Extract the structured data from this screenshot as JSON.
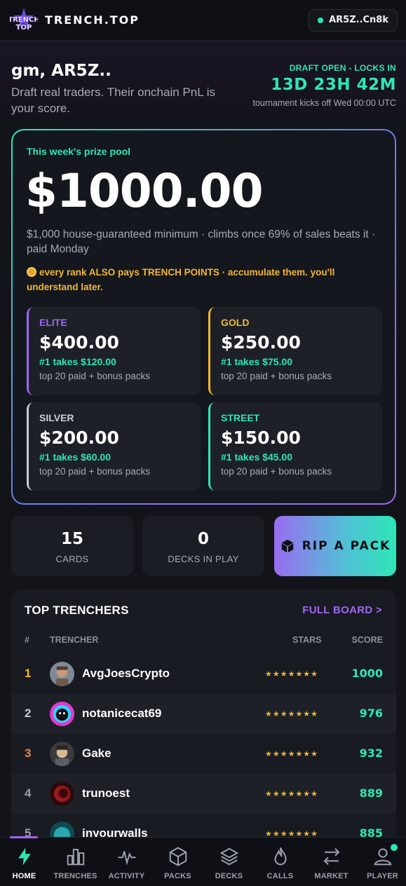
{
  "brand": {
    "logo_text": "TRENCH TOP",
    "name": "TRENCH.TOP",
    "wallet": "AR5Z..Cn8k"
  },
  "hero": {
    "greeting": "gm, AR5Z..",
    "tagline": "Draft real traders. Their onchain PnL is your score.",
    "draft_label": "DRAFT OPEN - LOCKS IN",
    "draft_time": "13D 23H 42M",
    "draft_note": "tournament kicks off Wed 00:00 UTC"
  },
  "prize_pool": {
    "label": "This week's prize pool",
    "amount": "$1000.00",
    "description": "$1,000 house-guaranteed minimum · climbs once 69% of sales beats it · paid Monday",
    "points_note": "every rank ALSO pays TRENCH POINTS · accumulate them. you'll understand later.",
    "tiers": [
      {
        "name": "ELITE",
        "amount": "$400.00",
        "top": "#1 takes $120.00",
        "sub": "top 20 paid + bonus packs",
        "color": "#a266f2"
      },
      {
        "name": "GOLD",
        "amount": "$250.00",
        "top": "#1 takes $75.00",
        "sub": "top 20 paid + bonus packs",
        "color": "#f2b733"
      },
      {
        "name": "SILVER",
        "amount": "$200.00",
        "top": "#1 takes $60.00",
        "sub": "top 20 paid + bonus packs",
        "color": "#c9cdd6"
      },
      {
        "name": "STREET",
        "amount": "$150.00",
        "top": "#1 takes $45.00",
        "sub": "top 20 paid + bonus packs",
        "color": "#2ee6b6"
      }
    ]
  },
  "stats": {
    "cards_value": "15",
    "cards_label": "CARDS",
    "decks_value": "0",
    "decks_label": "DECKS IN PLAY",
    "rip_label": "RIP A PACK"
  },
  "leaderboard": {
    "title": "TOP TRENCHERS",
    "link": "FULL BOARD >",
    "headers": {
      "rank": "#",
      "trencher": "TRENCHER",
      "stars": "STARS",
      "score": "SCORE"
    },
    "rows": [
      {
        "rank": "1",
        "name": "AvgJoesCrypto",
        "stars": "★★★★★★★",
        "score": "1000",
        "rank_color": "#f2b733"
      },
      {
        "rank": "2",
        "name": "notanicecat69",
        "stars": "★★★★★★★",
        "score": "976",
        "rank_color": "#c9cdd6"
      },
      {
        "rank": "3",
        "name": "Gake",
        "stars": "★★★★★★★",
        "score": "932",
        "rank_color": "#e8864a"
      },
      {
        "rank": "4",
        "name": "trunoest",
        "stars": "★★★★★★★",
        "score": "889",
        "rank_color": "#9aa0ad"
      },
      {
        "rank": "5",
        "name": "inyourwalls",
        "stars": "★★★★★★★",
        "score": "885",
        "rank_color": "#9aa0ad"
      }
    ]
  },
  "nav": {
    "items": [
      {
        "label": "HOME",
        "icon": "bolt-icon"
      },
      {
        "label": "TRENCHES",
        "icon": "bar-chart-icon"
      },
      {
        "label": "ACTIVITY",
        "icon": "pulse-icon"
      },
      {
        "label": "PACKS",
        "icon": "cube-icon"
      },
      {
        "label": "DECKS",
        "icon": "layers-icon"
      },
      {
        "label": "CALLS",
        "icon": "flame-icon"
      },
      {
        "label": "MARKET",
        "icon": "swap-icon"
      },
      {
        "label": "PLAYER",
        "icon": "user-icon"
      }
    ]
  },
  "colors": {
    "accent_teal": "#2ee6b6",
    "accent_purple": "#a266f2",
    "accent_gold": "#f2b733",
    "background": "#121419"
  }
}
